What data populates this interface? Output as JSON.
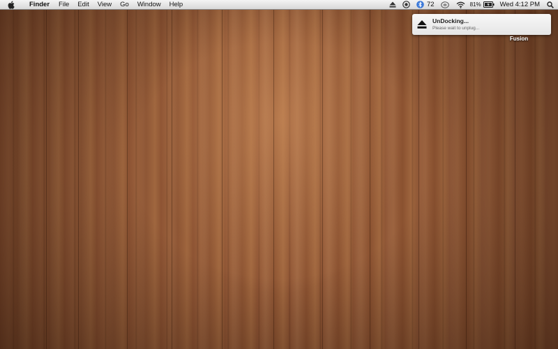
{
  "menubar": {
    "app_name": "Finder",
    "menus": [
      "File",
      "Edit",
      "View",
      "Go",
      "Window",
      "Help"
    ],
    "status": {
      "bluetooth_count": "72",
      "battery_percent": "81%",
      "clock": "Wed 4:12 PM"
    },
    "icons": [
      "apple-icon",
      "eject-icon",
      "sync-icon",
      "bluetooth-icon",
      "display-icon",
      "wifi-icon",
      "battery-icon",
      "spotlight-icon"
    ]
  },
  "notification": {
    "title": "UnDocking...",
    "body": "Please wait to unplug...",
    "icon": "eject-icon"
  },
  "desktop": {
    "label": "Fusion"
  }
}
